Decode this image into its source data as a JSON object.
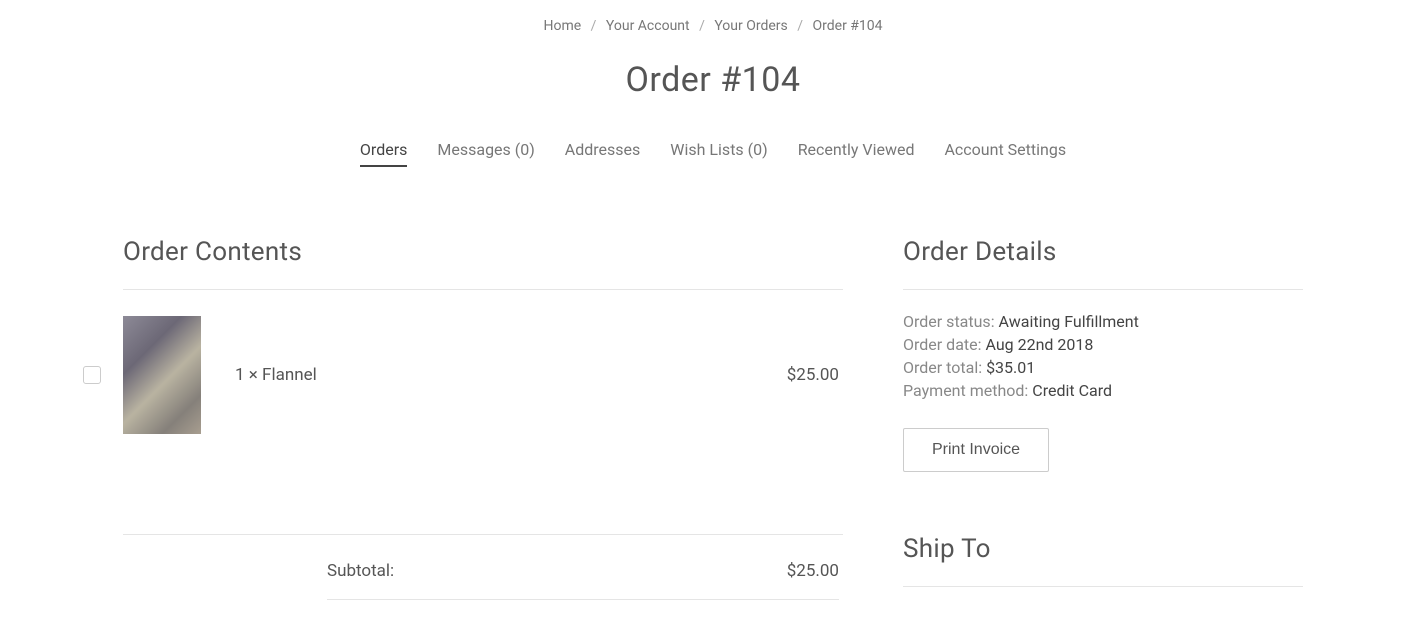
{
  "breadcrumb": {
    "items": [
      "Home",
      "Your Account",
      "Your Orders",
      "Order #104"
    ]
  },
  "page_title": "Order #104",
  "tabs": [
    {
      "label": "Orders",
      "active": true
    },
    {
      "label": "Messages (0)",
      "active": false
    },
    {
      "label": "Addresses",
      "active": false
    },
    {
      "label": "Wish Lists (0)",
      "active": false
    },
    {
      "label": "Recently Viewed",
      "active": false
    },
    {
      "label": "Account Settings",
      "active": false
    }
  ],
  "order_contents": {
    "heading": "Order Contents",
    "items": [
      {
        "qty_name": "1 × Flannel",
        "price": "$25.00"
      }
    ],
    "subtotal_label": "Subtotal:",
    "subtotal_value": "$25.00"
  },
  "order_details": {
    "heading": "Order Details",
    "status_label": "Order status:",
    "status_value": "Awaiting Fulfillment",
    "date_label": "Order date:",
    "date_value": "Aug 22nd 2018",
    "total_label": "Order total:",
    "total_value": "$35.01",
    "payment_label": "Payment method:",
    "payment_value": "Credit Card",
    "print_button": "Print Invoice"
  },
  "ship_to": {
    "heading": "Ship To"
  }
}
